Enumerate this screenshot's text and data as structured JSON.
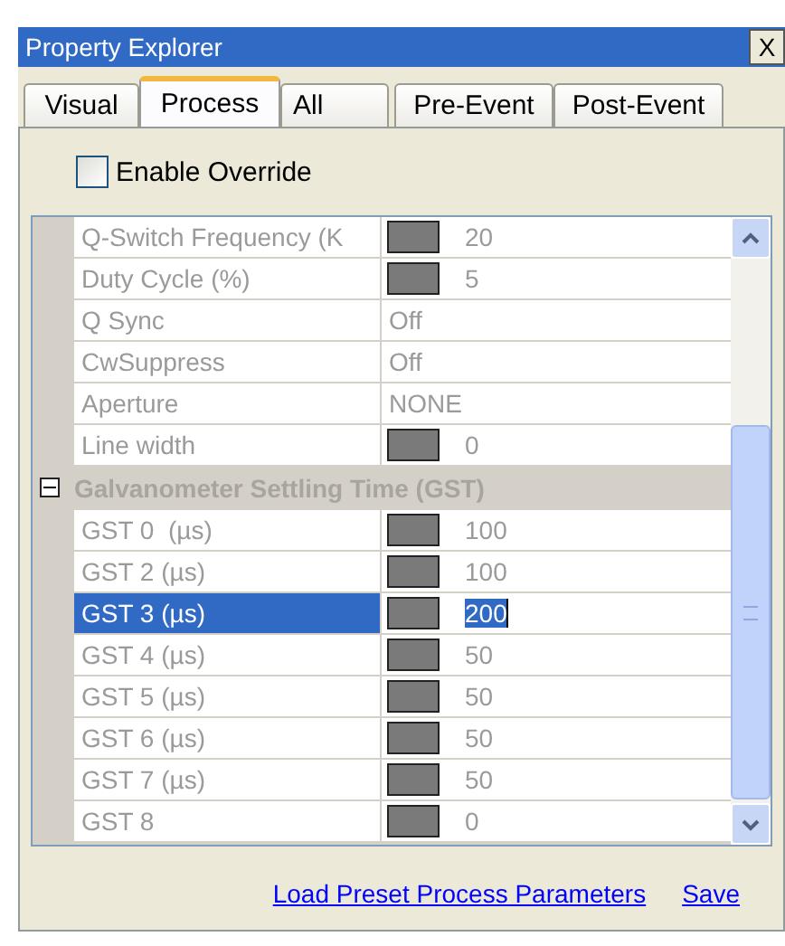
{
  "window": {
    "title": "Property Explorer",
    "close": "X"
  },
  "tabs": [
    {
      "label": "Visual",
      "selected": false
    },
    {
      "label": "Process",
      "selected": true
    },
    {
      "label": "All",
      "selected": false
    },
    {
      "label": "Pre-Event",
      "selected": false
    },
    {
      "label": "Post-Event",
      "selected": false
    }
  ],
  "override": {
    "label": "Enable Override",
    "checked": false
  },
  "grid": [
    {
      "kind": "property",
      "name": "Q-Switch Frequency (K",
      "value": "20",
      "swatch": true,
      "selected": false
    },
    {
      "kind": "property",
      "name": "Duty Cycle (%)",
      "value": "5",
      "swatch": true,
      "selected": false
    },
    {
      "kind": "property",
      "name": "Q Sync",
      "value": "Off",
      "swatch": false,
      "selected": false
    },
    {
      "kind": "property",
      "name": "CwSuppress",
      "value": "Off",
      "swatch": false,
      "selected": false
    },
    {
      "kind": "property",
      "name": "Aperture",
      "value": "NONE",
      "swatch": false,
      "selected": false
    },
    {
      "kind": "property",
      "name": "Line width",
      "value": "0",
      "swatch": true,
      "selected": false
    },
    {
      "kind": "group",
      "name": "Galvanometer Settling Time (GST)",
      "expanded": true,
      "children": [
        {
          "kind": "property",
          "name": "GST 0  (µs)",
          "value": "100",
          "swatch": true,
          "selected": false
        },
        {
          "kind": "property",
          "name": "GST 2 (µs)",
          "value": "100",
          "swatch": true,
          "selected": false
        },
        {
          "kind": "property",
          "name": "GST 3 (µs)",
          "value": "200",
          "swatch": true,
          "selected": true
        },
        {
          "kind": "property",
          "name": "GST 4 (µs)",
          "value": "50",
          "swatch": true,
          "selected": false
        },
        {
          "kind": "property",
          "name": "GST 5 (µs)",
          "value": "50",
          "swatch": true,
          "selected": false
        },
        {
          "kind": "property",
          "name": "GST 6 (µs)",
          "value": "50",
          "swatch": true,
          "selected": false
        },
        {
          "kind": "property",
          "name": "GST 7 (µs)",
          "value": "50",
          "swatch": true,
          "selected": false
        },
        {
          "kind": "property",
          "name": "GST 8",
          "value": "0",
          "swatch": true,
          "selected": false
        }
      ]
    }
  ],
  "links": [
    "Load Preset Process Parameters",
    "Save"
  ]
}
